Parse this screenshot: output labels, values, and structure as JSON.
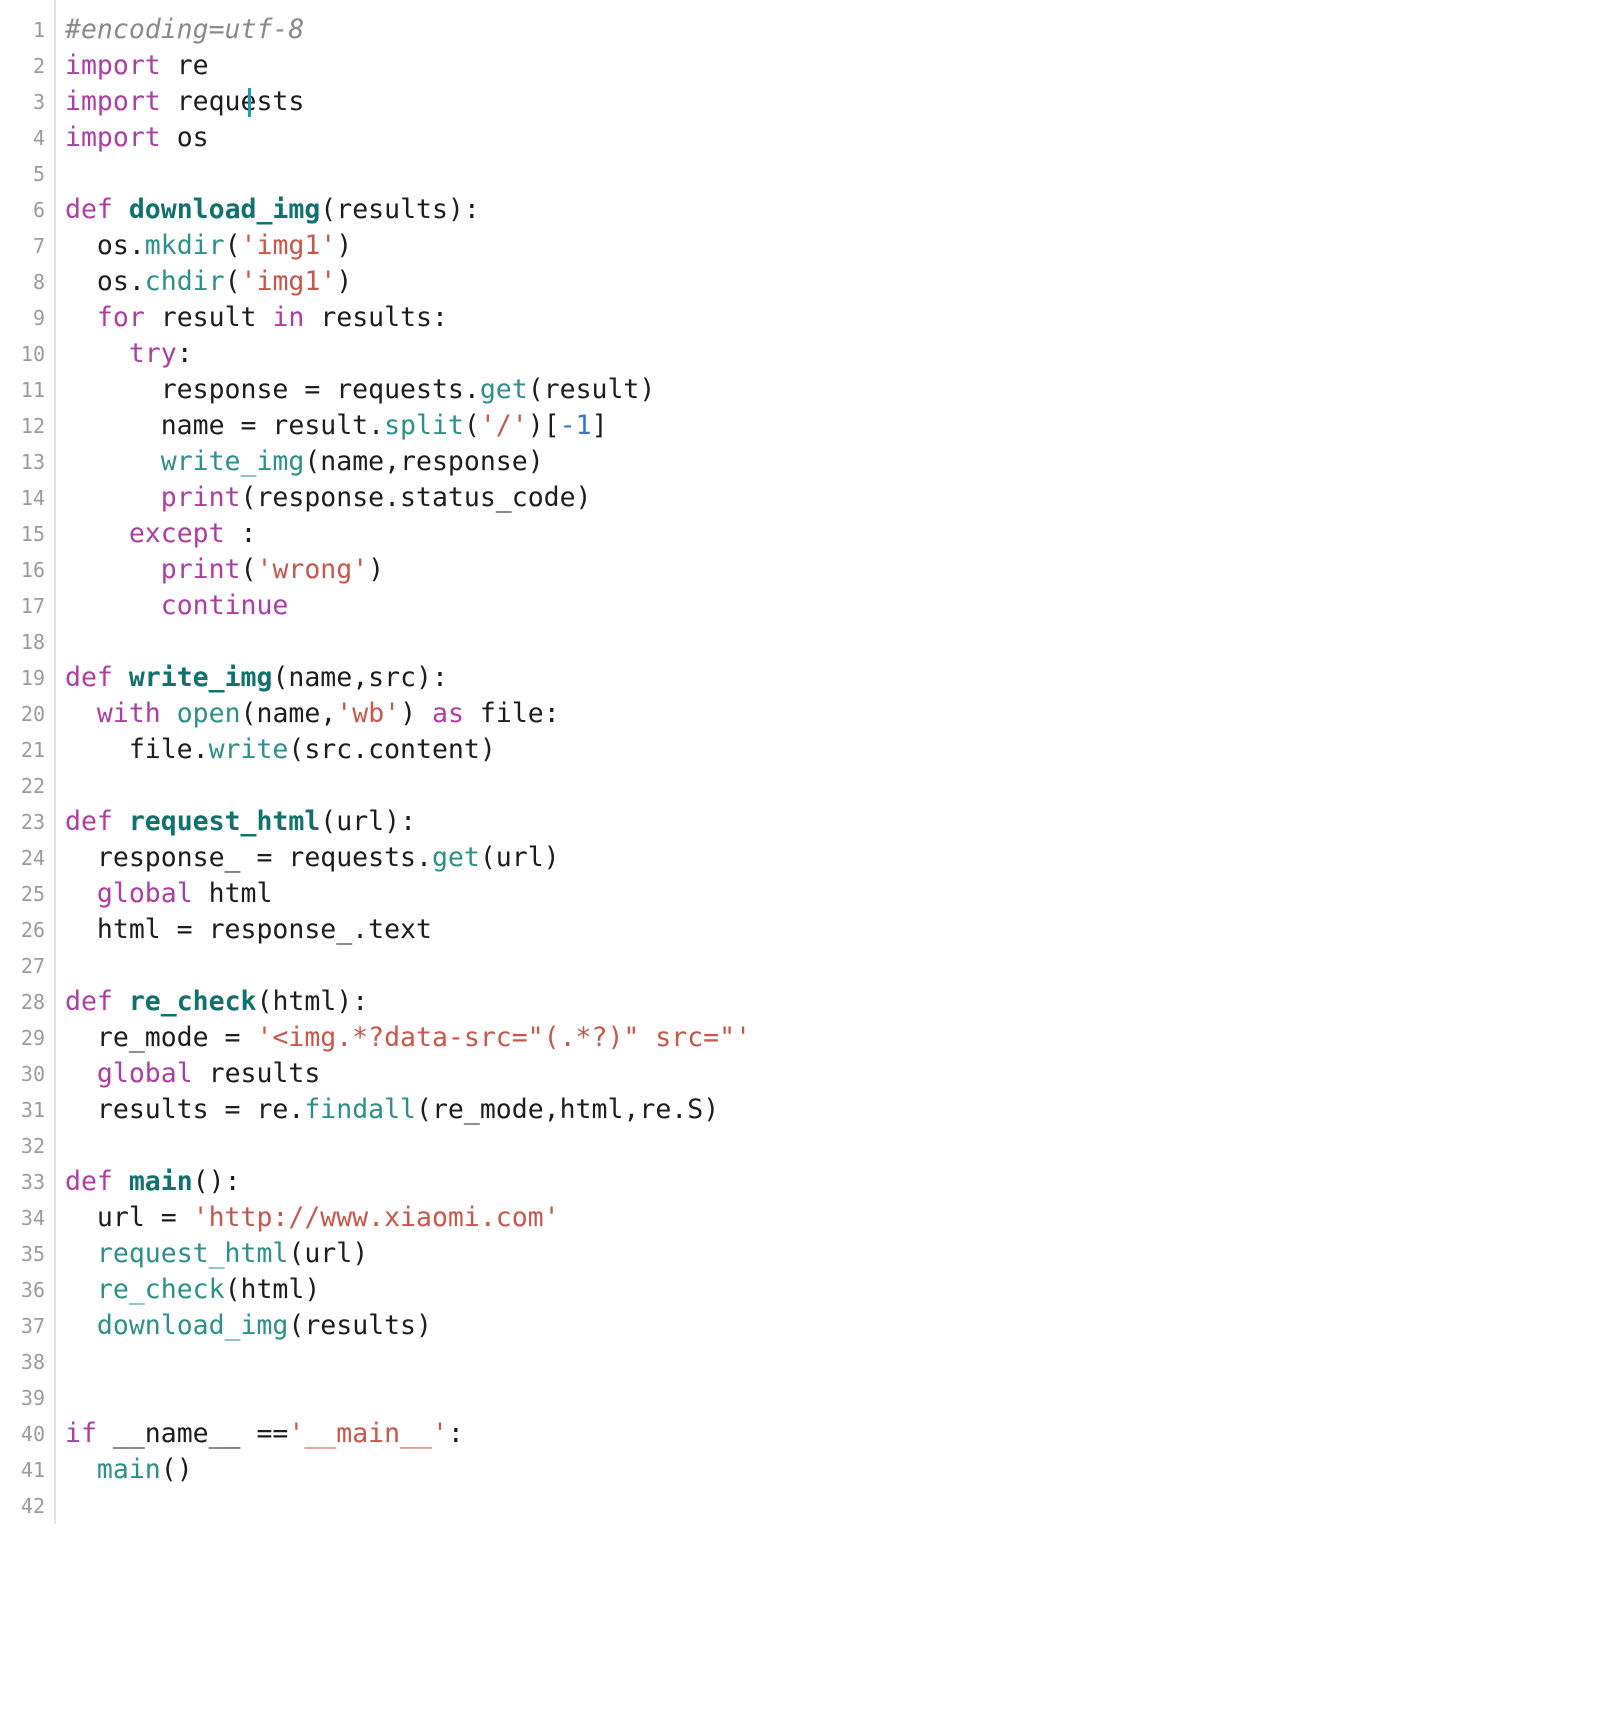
{
  "editor": {
    "language": "python",
    "total_lines": 42,
    "colors": {
      "background": "#ffffff",
      "gutter_text": "#9b9b9b",
      "gutter_border": "#e3e3e3",
      "comment": "#8a8a8a",
      "keyword": "#ab3fa0",
      "function_def": "#12716c",
      "function_call": "#2f8f87",
      "string": "#c4584d",
      "number": "#3b74c4",
      "plain_text": "#1d1d1d",
      "caret": "#1f9aa8"
    },
    "caret": {
      "line": 3,
      "column": 15,
      "after_text": "import requests"
    },
    "line_numbers": [
      "1",
      "2",
      "3",
      "4",
      "5",
      "6",
      "7",
      "8",
      "9",
      "10",
      "11",
      "12",
      "13",
      "14",
      "15",
      "16",
      "17",
      "18",
      "19",
      "20",
      "21",
      "22",
      "23",
      "24",
      "25",
      "26",
      "27",
      "28",
      "29",
      "30",
      "31",
      "32",
      "33",
      "34",
      "35",
      "36",
      "37",
      "38",
      "39",
      "40",
      "41",
      "42"
    ],
    "lines": [
      {
        "n": 1,
        "text": "#encoding=utf-8",
        "tokens": [
          {
            "t": "#encoding=utf-8",
            "c": "t-comment"
          }
        ]
      },
      {
        "n": 2,
        "text": "import re",
        "tokens": [
          {
            "t": "import",
            "c": "t-keyword"
          },
          {
            "t": " re",
            "c": "t-plain"
          }
        ]
      },
      {
        "n": 3,
        "text": "import requests",
        "tokens": [
          {
            "t": "import",
            "c": "t-keyword"
          },
          {
            "t": " requests",
            "c": "t-plain"
          }
        ]
      },
      {
        "n": 4,
        "text": "import os",
        "tokens": [
          {
            "t": "import",
            "c": "t-keyword"
          },
          {
            "t": " os",
            "c": "t-plain"
          }
        ]
      },
      {
        "n": 5,
        "text": "",
        "tokens": []
      },
      {
        "n": 6,
        "text": "def download_img(results):",
        "tokens": [
          {
            "t": "def",
            "c": "t-keyword"
          },
          {
            "t": " ",
            "c": "t-plain"
          },
          {
            "t": "download_img",
            "c": "t-deffunc"
          },
          {
            "t": "(results):",
            "c": "t-plain"
          }
        ]
      },
      {
        "n": 7,
        "text": "  os.mkdir('img1')",
        "tokens": [
          {
            "t": "  os.",
            "c": "t-plain"
          },
          {
            "t": "mkdir",
            "c": "t-call"
          },
          {
            "t": "(",
            "c": "t-plain"
          },
          {
            "t": "'img1'",
            "c": "t-string"
          },
          {
            "t": ")",
            "c": "t-plain"
          }
        ]
      },
      {
        "n": 8,
        "text": "  os.chdir('img1')",
        "tokens": [
          {
            "t": "  os.",
            "c": "t-plain"
          },
          {
            "t": "chdir",
            "c": "t-call"
          },
          {
            "t": "(",
            "c": "t-plain"
          },
          {
            "t": "'img1'",
            "c": "t-string"
          },
          {
            "t": ")",
            "c": "t-plain"
          }
        ]
      },
      {
        "n": 9,
        "text": "  for result in results:",
        "tokens": [
          {
            "t": "  ",
            "c": "t-plain"
          },
          {
            "t": "for",
            "c": "t-keyword"
          },
          {
            "t": " result ",
            "c": "t-plain"
          },
          {
            "t": "in",
            "c": "t-keyword"
          },
          {
            "t": " results:",
            "c": "t-plain"
          }
        ]
      },
      {
        "n": 10,
        "text": "    try:",
        "tokens": [
          {
            "t": "    ",
            "c": "t-plain"
          },
          {
            "t": "try",
            "c": "t-keyword"
          },
          {
            "t": ":",
            "c": "t-plain"
          }
        ]
      },
      {
        "n": 11,
        "text": "      response = requests.get(result)",
        "tokens": [
          {
            "t": "      response = requests.",
            "c": "t-plain"
          },
          {
            "t": "get",
            "c": "t-call"
          },
          {
            "t": "(result)",
            "c": "t-plain"
          }
        ]
      },
      {
        "n": 12,
        "text": "      name = result.split('/')[-1]",
        "tokens": [
          {
            "t": "      name = result.",
            "c": "t-plain"
          },
          {
            "t": "split",
            "c": "t-call"
          },
          {
            "t": "(",
            "c": "t-plain"
          },
          {
            "t": "'/'",
            "c": "t-string"
          },
          {
            "t": ")[",
            "c": "t-plain"
          },
          {
            "t": "-1",
            "c": "t-number"
          },
          {
            "t": "]",
            "c": "t-plain"
          }
        ]
      },
      {
        "n": 13,
        "text": "      write_img(name,response)",
        "tokens": [
          {
            "t": "      ",
            "c": "t-plain"
          },
          {
            "t": "write_img",
            "c": "t-call"
          },
          {
            "t": "(name,response)",
            "c": "t-plain"
          }
        ]
      },
      {
        "n": 14,
        "text": "      print(response.status_code)",
        "tokens": [
          {
            "t": "      ",
            "c": "t-plain"
          },
          {
            "t": "print",
            "c": "t-keyword"
          },
          {
            "t": "(response.status_code)",
            "c": "t-plain"
          }
        ]
      },
      {
        "n": 15,
        "text": "    except :",
        "tokens": [
          {
            "t": "    ",
            "c": "t-plain"
          },
          {
            "t": "except",
            "c": "t-keyword"
          },
          {
            "t": " :",
            "c": "t-plain"
          }
        ]
      },
      {
        "n": 16,
        "text": "      print('wrong')",
        "tokens": [
          {
            "t": "      ",
            "c": "t-plain"
          },
          {
            "t": "print",
            "c": "t-keyword"
          },
          {
            "t": "(",
            "c": "t-plain"
          },
          {
            "t": "'wrong'",
            "c": "t-string"
          },
          {
            "t": ")",
            "c": "t-plain"
          }
        ]
      },
      {
        "n": 17,
        "text": "      continue",
        "tokens": [
          {
            "t": "      ",
            "c": "t-plain"
          },
          {
            "t": "continue",
            "c": "t-keyword"
          }
        ]
      },
      {
        "n": 18,
        "text": "",
        "tokens": []
      },
      {
        "n": 19,
        "text": "def write_img(name,src):",
        "tokens": [
          {
            "t": "def",
            "c": "t-keyword"
          },
          {
            "t": " ",
            "c": "t-plain"
          },
          {
            "t": "write_img",
            "c": "t-deffunc"
          },
          {
            "t": "(name,src):",
            "c": "t-plain"
          }
        ]
      },
      {
        "n": 20,
        "text": "  with open(name,'wb') as file:",
        "tokens": [
          {
            "t": "  ",
            "c": "t-plain"
          },
          {
            "t": "with",
            "c": "t-keyword"
          },
          {
            "t": " ",
            "c": "t-plain"
          },
          {
            "t": "open",
            "c": "t-call"
          },
          {
            "t": "(name,",
            "c": "t-plain"
          },
          {
            "t": "'wb'",
            "c": "t-string"
          },
          {
            "t": ") ",
            "c": "t-plain"
          },
          {
            "t": "as",
            "c": "t-keyword"
          },
          {
            "t": " file:",
            "c": "t-plain"
          }
        ]
      },
      {
        "n": 21,
        "text": "    file.write(src.content)",
        "tokens": [
          {
            "t": "    file.",
            "c": "t-plain"
          },
          {
            "t": "write",
            "c": "t-call"
          },
          {
            "t": "(src.content)",
            "c": "t-plain"
          }
        ]
      },
      {
        "n": 22,
        "text": "",
        "tokens": []
      },
      {
        "n": 23,
        "text": "def request_html(url):",
        "tokens": [
          {
            "t": "def",
            "c": "t-keyword"
          },
          {
            "t": " ",
            "c": "t-plain"
          },
          {
            "t": "request_html",
            "c": "t-deffunc"
          },
          {
            "t": "(url):",
            "c": "t-plain"
          }
        ]
      },
      {
        "n": 24,
        "text": "  response_ = requests.get(url)",
        "tokens": [
          {
            "t": "  response_ = requests.",
            "c": "t-plain"
          },
          {
            "t": "get",
            "c": "t-call"
          },
          {
            "t": "(url)",
            "c": "t-plain"
          }
        ]
      },
      {
        "n": 25,
        "text": "  global html",
        "tokens": [
          {
            "t": "  ",
            "c": "t-plain"
          },
          {
            "t": "global",
            "c": "t-keyword"
          },
          {
            "t": " html",
            "c": "t-plain"
          }
        ]
      },
      {
        "n": 26,
        "text": "  html = response_.text",
        "tokens": [
          {
            "t": "  html = response_.text",
            "c": "t-plain"
          }
        ]
      },
      {
        "n": 27,
        "text": "",
        "tokens": []
      },
      {
        "n": 28,
        "text": "def re_check(html):",
        "tokens": [
          {
            "t": "def",
            "c": "t-keyword"
          },
          {
            "t": " ",
            "c": "t-plain"
          },
          {
            "t": "re_check",
            "c": "t-deffunc"
          },
          {
            "t": "(html):",
            "c": "t-plain"
          }
        ]
      },
      {
        "n": 29,
        "text": "  re_mode = '<img.*?data-src=\"(.*?)\" src=\"'",
        "tokens": [
          {
            "t": "  re_mode = ",
            "c": "t-plain"
          },
          {
            "t": "'<img.*?data-src=\"(.*?)\" src=\"'",
            "c": "t-string"
          }
        ]
      },
      {
        "n": 30,
        "text": "  global results",
        "tokens": [
          {
            "t": "  ",
            "c": "t-plain"
          },
          {
            "t": "global",
            "c": "t-keyword"
          },
          {
            "t": " results",
            "c": "t-plain"
          }
        ]
      },
      {
        "n": 31,
        "text": "  results = re.findall(re_mode,html,re.S)",
        "tokens": [
          {
            "t": "  results = re.",
            "c": "t-plain"
          },
          {
            "t": "findall",
            "c": "t-call"
          },
          {
            "t": "(re_mode,html,re.S)",
            "c": "t-plain"
          }
        ]
      },
      {
        "n": 32,
        "text": "",
        "tokens": []
      },
      {
        "n": 33,
        "text": "def main():",
        "tokens": [
          {
            "t": "def",
            "c": "t-keyword"
          },
          {
            "t": " ",
            "c": "t-plain"
          },
          {
            "t": "main",
            "c": "t-deffunc"
          },
          {
            "t": "():",
            "c": "t-plain"
          }
        ]
      },
      {
        "n": 34,
        "text": "  url = 'http://www.xiaomi.com'",
        "tokens": [
          {
            "t": "  url = ",
            "c": "t-plain"
          },
          {
            "t": "'http://www.xiaomi.com'",
            "c": "t-string"
          }
        ]
      },
      {
        "n": 35,
        "text": "  request_html(url)",
        "tokens": [
          {
            "t": "  ",
            "c": "t-plain"
          },
          {
            "t": "request_html",
            "c": "t-call"
          },
          {
            "t": "(url)",
            "c": "t-plain"
          }
        ]
      },
      {
        "n": 36,
        "text": "  re_check(html)",
        "tokens": [
          {
            "t": "  ",
            "c": "t-plain"
          },
          {
            "t": "re_check",
            "c": "t-call"
          },
          {
            "t": "(html)",
            "c": "t-plain"
          }
        ]
      },
      {
        "n": 37,
        "text": "  download_img(results)",
        "tokens": [
          {
            "t": "  ",
            "c": "t-plain"
          },
          {
            "t": "download_img",
            "c": "t-call"
          },
          {
            "t": "(results)",
            "c": "t-plain"
          }
        ]
      },
      {
        "n": 38,
        "text": "",
        "tokens": []
      },
      {
        "n": 39,
        "text": "",
        "tokens": []
      },
      {
        "n": 40,
        "text": "if __name__ =='__main__':",
        "tokens": [
          {
            "t": "if",
            "c": "t-keyword"
          },
          {
            "t": " __name__ ==",
            "c": "t-plain"
          },
          {
            "t": "'__main__'",
            "c": "t-string"
          },
          {
            "t": ":",
            "c": "t-plain"
          }
        ]
      },
      {
        "n": 41,
        "text": "  main()",
        "tokens": [
          {
            "t": "  ",
            "c": "t-plain"
          },
          {
            "t": "main",
            "c": "t-call"
          },
          {
            "t": "()",
            "c": "t-plain"
          }
        ]
      },
      {
        "n": 42,
        "text": "",
        "tokens": []
      }
    ]
  }
}
